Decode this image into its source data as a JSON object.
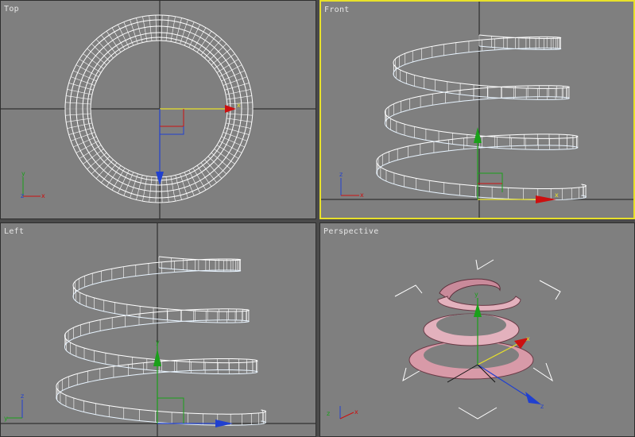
{
  "viewports": {
    "top": {
      "label": "Top"
    },
    "front": {
      "label": "Front"
    },
    "left": {
      "label": "Left"
    },
    "perspective": {
      "label": "Perspective"
    }
  },
  "colors": {
    "viewport_bg": "#7f7f7f",
    "grid_line": "#1c1c1c",
    "wire": "#ffffff",
    "active_border": "#e8e12a",
    "axis_x": "#cc1010",
    "axis_y": "#1aa01a",
    "axis_z": "#2040d0",
    "gizmo_yellow": "#e8e12a",
    "object_pink": "#d89aa8",
    "object_pink_dark": "#6a3a46"
  },
  "axis_tripods": {
    "top": [
      "y",
      "z",
      "x"
    ],
    "front": [
      "z",
      "x"
    ],
    "left": [
      "z",
      "y"
    ],
    "perspective": [
      "z",
      "x"
    ]
  }
}
